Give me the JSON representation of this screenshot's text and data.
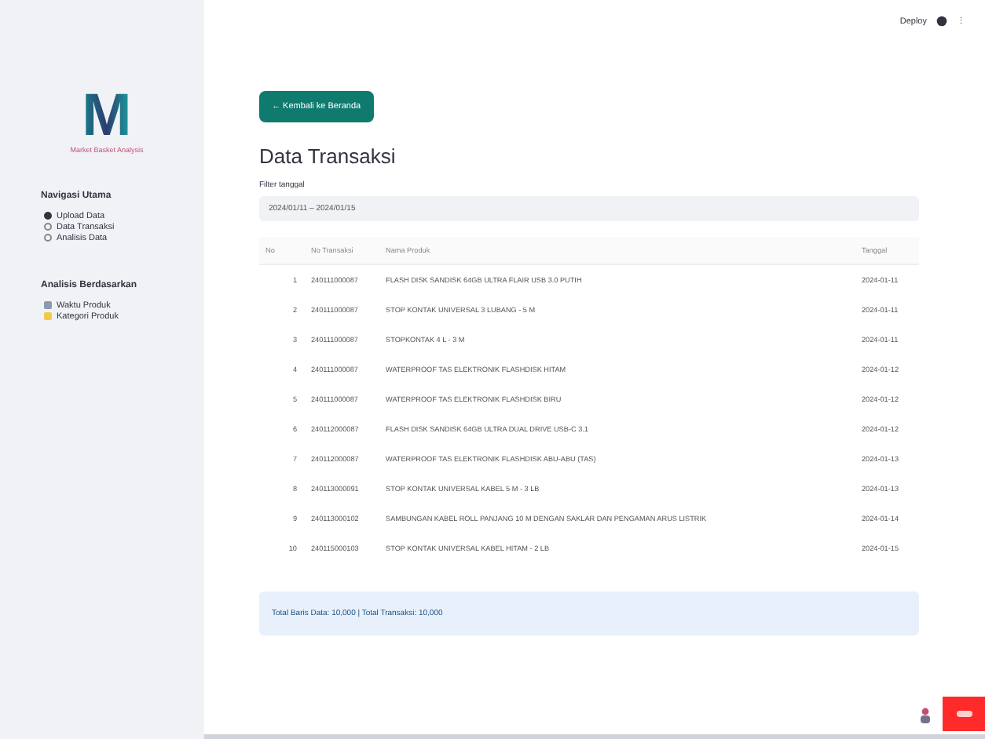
{
  "header": {
    "deploy": "Deploy",
    "menu": "⋮"
  },
  "sidebar": {
    "logo": {
      "letter": "M",
      "subtitle": "Market Basket Analysis"
    },
    "groups": [
      {
        "title": "Navigasi Utama",
        "items": [
          {
            "label": "Upload Data",
            "selected": true
          },
          {
            "label": "Data Transaksi",
            "selected": false
          },
          {
            "label": "Analisis Data",
            "selected": false
          }
        ]
      },
      {
        "title": "Analisis Berdasarkan",
        "items": [
          {
            "label": "Waktu Produk",
            "selected": false
          },
          {
            "label": "Kategori Produk",
            "selected": false
          }
        ]
      }
    ]
  },
  "back_button": "← Kembali ke Beranda",
  "title": "Data Transaksi",
  "filter": {
    "label": "Filter tanggal",
    "value": "2024/01/11 – 2024/01/15"
  },
  "table": {
    "columns": [
      "No",
      "No Transaksi",
      "Nama Produk",
      "Tanggal"
    ],
    "rows": [
      [
        "1",
        "240111000087",
        "FLASH DISK SANDISK 64GB ULTRA FLAIR USB 3.0 PUTIH",
        "2024-01-11"
      ],
      [
        "2",
        "240111000087",
        "STOP KONTAK UNIVERSAL 3 LUBANG - 5 M",
        "2024-01-11"
      ],
      [
        "3",
        "240111000087",
        "STOPKONTAK 4 L - 3 M",
        "2024-01-11"
      ],
      [
        "4",
        "240111000087",
        "WATERPROOF TAS ELEKTRONIK FLASHDISK HITAM",
        "2024-01-12"
      ],
      [
        "5",
        "240111000087",
        "WATERPROOF TAS ELEKTRONIK FLASHDISK BIRU",
        "2024-01-12"
      ],
      [
        "6",
        "240112000087",
        "FLASH DISK SANDISK 64GB ULTRA DUAL DRIVE USB-C 3.1",
        "2024-01-12"
      ],
      [
        "7",
        "240112000087",
        "WATERPROOF TAS ELEKTRONIK FLASHDISK ABU-ABU (TAS)",
        "2024-01-13"
      ],
      [
        "8",
        "240113000091",
        "STOP KONTAK UNIVERSAL KABEL 5 M - 3 LB",
        "2024-01-13"
      ],
      [
        "9",
        "240113000102",
        "SAMBUNGAN KABEL ROLL PANJANG 10 M DENGAN SAKLAR DAN PENGAMAN ARUS LISTRIK",
        "2024-01-14"
      ],
      [
        "10",
        "240115000103",
        "STOP KONTAK UNIVERSAL KABEL HITAM - 2 LB",
        "2024-01-15"
      ]
    ]
  },
  "summary": "Total Baris Data: 10,000 | Total Transaksi: 10,000"
}
